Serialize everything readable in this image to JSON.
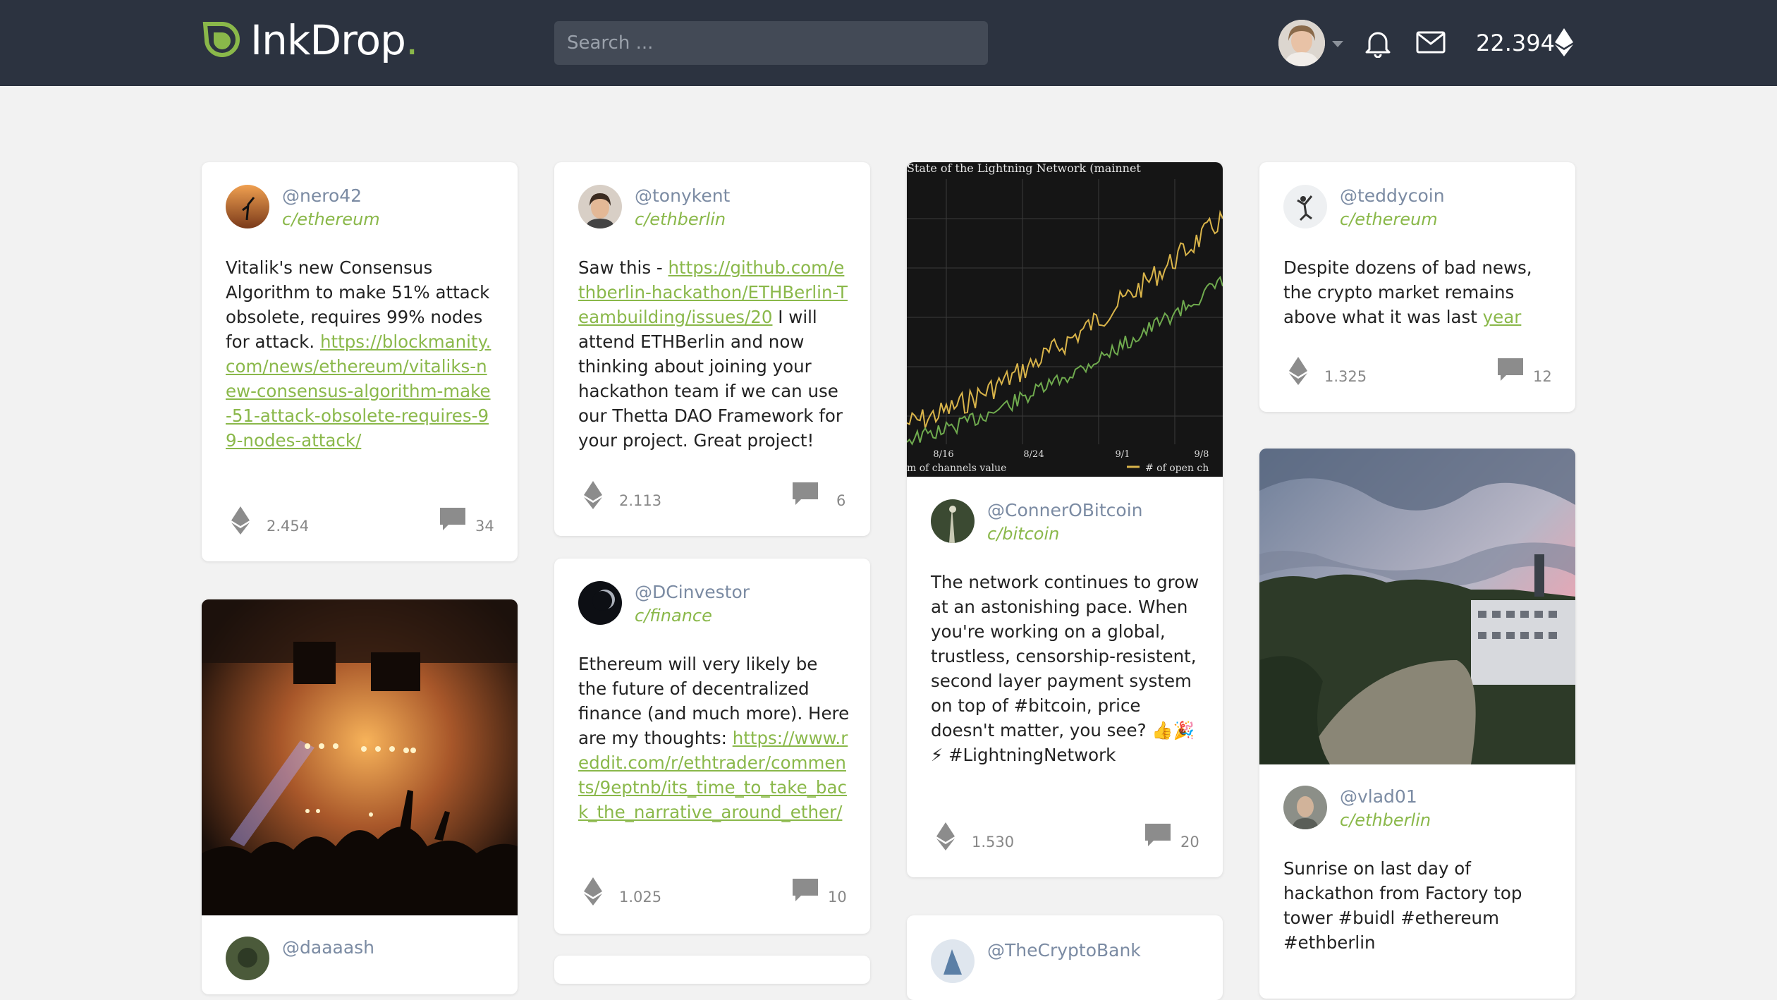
{
  "header": {
    "logo_text": "InkDrop",
    "logo_dot": ".",
    "search_placeholder": "Search ...",
    "balance": "22.394",
    "icons": [
      "logo-drop-icon",
      "user-avatar",
      "caret-down-icon",
      "bell-icon",
      "mail-icon",
      "ethereum-icon"
    ]
  },
  "colors": {
    "topbar": "#2c3340",
    "accent": "#8ab84a",
    "handle": "#7b8ba3",
    "background": "#f2f2f2"
  },
  "posts": [
    {
      "handle": "@nero42",
      "community": "c/ethereum",
      "text_before": "Vitalik's new Consensus Algorithm to make 51% attack obsolete, requires 99% nodes for attack. ",
      "link": "https://blockmanity.com/news/ethereum/vitaliks-new-consensus-algorithm-make-51-attack-obsolete-requires-99-nodes-attack/",
      "text_after": "",
      "votes": "2.454",
      "comments": "34"
    },
    {
      "handle": "@tonykent",
      "community": "c/ethberlin",
      "text_before": "Saw this - ",
      "link": "https://github.com/ethberlin-hackathon/ETHBerlin-Teambuilding/issues/20",
      "text_after": " I will attend ETHBerlin and now thinking about joining your hackathon team if we can use our Thetta DAO Framework for your project. Great project!",
      "votes": "2.113",
      "comments": "6"
    },
    {
      "handle": "@ConnerOBitcoin",
      "community": "c/bitcoin",
      "text_before": "The network continues to grow at an astonishing pace. When you're working on a global, trustless, censorship-resistent, second layer payment system on top of #bitcoin, price doesn't matter, you see? 👍🎉⚡ #LightningNetwork",
      "link": "",
      "text_after": "",
      "votes": "1.530",
      "comments": "20"
    },
    {
      "handle": "@teddycoin",
      "community": "c/ethereum",
      "text_before": "Despite dozens of bad news, the crypto market remains above what it was last ",
      "link": "year",
      "text_after": "",
      "votes": "1.325",
      "comments": "12"
    },
    {
      "handle": "@DCinvestor",
      "community": "c/finance",
      "text_before": "Ethereum will very likely be the future of decentralized finance (and much more).  Here are my thoughts: ",
      "link": "https://www.reddit.com/r/ethtrader/comments/9eptnb/its_time_to_take_back_the_narrative_around_ether/",
      "text_after": "",
      "votes": "1.025",
      "comments": "10"
    },
    {
      "handle": "@vlad01",
      "community": "c/ethberlin",
      "text_before": "Sunrise on last day of hackathon from Factory top tower #buidl #ethereum #ethberlin",
      "link": "",
      "text_after": "",
      "votes": "",
      "comments": ""
    },
    {
      "handle": "@daaaash",
      "community": "",
      "text_before": "",
      "link": "",
      "text_after": "",
      "votes": "",
      "comments": ""
    },
    {
      "handle": "@TheCryptoBank",
      "community": "",
      "text_before": "",
      "link": "",
      "text_after": "",
      "votes": "",
      "comments": ""
    }
  ],
  "lightning_chart": {
    "title": "State of the Lightning Network (mainnet",
    "x_ticks": [
      "8/16",
      "8/24",
      "9/1",
      "9/8"
    ],
    "legend_left": "m of channels value",
    "legend_right": "# of open ch",
    "series_colors": {
      "value": "#d9b44a",
      "channels": "#6faa4e"
    }
  }
}
